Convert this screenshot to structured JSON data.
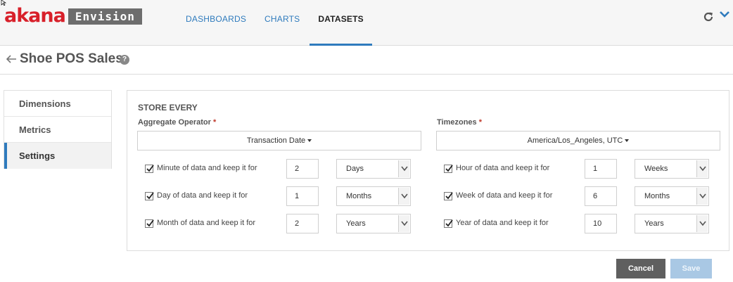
{
  "header": {
    "logo": "akana",
    "product": "Envision",
    "nav": [
      "DASHBOARDS",
      "CHARTS",
      "DATASETS"
    ],
    "active_nav": "DATASETS",
    "icons": [
      "refresh-icon",
      "chevron-down-icon"
    ]
  },
  "page": {
    "title": "Shoe POS Sales",
    "help": "?"
  },
  "side_menu": {
    "items": [
      "Dimensions",
      "Metrics",
      "Settings"
    ],
    "active": "Settings"
  },
  "settings": {
    "section_title": "STORE EVERY",
    "aggregate_label": "Aggregate Operator",
    "aggregate_value": "Transaction Date",
    "timezone_label": "Timezones",
    "timezone_value": "America/Los_Angeles, UTC",
    "required_mark": "*",
    "left_rows": [
      {
        "checked": true,
        "label": "Minute of data and keep it for",
        "value": "2",
        "unit": "Days"
      },
      {
        "checked": true,
        "label": "Day of data and keep it for",
        "value": "1",
        "unit": "Months"
      },
      {
        "checked": true,
        "label": "Month of data and keep it for",
        "value": "2",
        "unit": "Years"
      }
    ],
    "right_rows": [
      {
        "checked": true,
        "label": "Hour of data and keep it for",
        "value": "1",
        "unit": "Weeks"
      },
      {
        "checked": true,
        "label": "Week of data and keep it for",
        "value": "6",
        "unit": "Months"
      },
      {
        "checked": true,
        "label": "Year of data and keep it for",
        "value": "10",
        "unit": "Years"
      }
    ]
  },
  "actions": {
    "cancel": "Cancel",
    "save": "Save"
  },
  "colors": {
    "brand_red": "#d8202a",
    "link_blue": "#2f7bbd",
    "cancel_bg": "#5f5f5f",
    "save_disabled_bg": "#a9c8e4"
  }
}
